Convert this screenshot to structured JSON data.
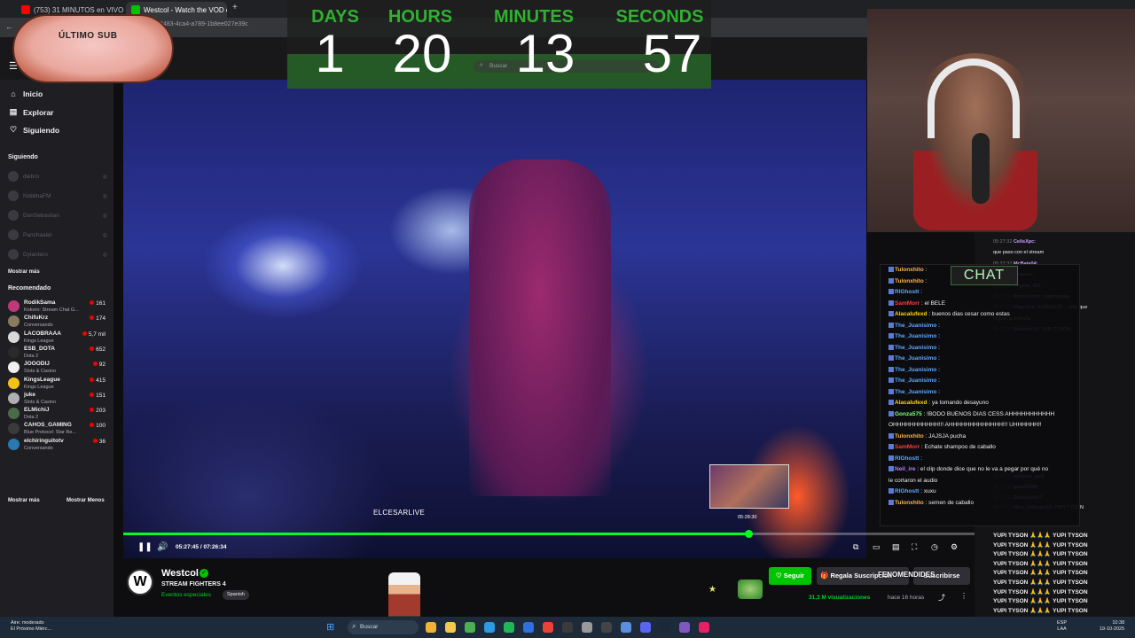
{
  "browser": {
    "tabs": [
      {
        "label": "(753) 31 MINUTOS en VIVO - T",
        "favicon_color": "#ff0000"
      },
      {
        "label": "Westcol - Watch the VOD o",
        "favicon_color": "#00c400"
      }
    ],
    "new_tab": "+",
    "address_fragment": "3483-4ca4-a789-1b8ee027e39c"
  },
  "countdown": {
    "labels": [
      "DAYS",
      "HOURS",
      "MINUTES",
      "SECONDS"
    ],
    "values": [
      "1",
      "20",
      "13",
      "57"
    ],
    "search_placeholder": "Buscar"
  },
  "badge": {
    "text": "ÚLTIMO SUB"
  },
  "sidebar": {
    "nav": [
      {
        "label": "Inicio",
        "icon": "home-icon"
      },
      {
        "label": "Explorar",
        "icon": "browse-icon"
      },
      {
        "label": "Siguiendo",
        "icon": "heart-icon"
      }
    ],
    "following_title": "Siguiendo",
    "following": [
      "diebro",
      "NobilnaFM",
      "DonSebastian",
      "Panchaalel",
      "Dylantero"
    ],
    "show_more": "Mostrar más",
    "recommended_title": "Recomendado",
    "recommended": [
      {
        "name": "RodikSama",
        "game": "Kokoro: Stream Chat G...",
        "viewers": "161",
        "color": "#c03a7a"
      },
      {
        "name": "ChifuKrz",
        "game": "Conversando",
        "viewers": "174",
        "color": "#8a7a60"
      },
      {
        "name": "LACOBRAAA",
        "game": "Kings League",
        "viewers": "5,7 mil",
        "color": "#d9d9d9"
      },
      {
        "name": "ESB_DOTA",
        "game": "Dota 2",
        "viewers": "652",
        "color": "#2a2a2a"
      },
      {
        "name": "JOOODIJ",
        "game": "Slots & Casino",
        "viewers": "92",
        "color": "#f0f0f0"
      },
      {
        "name": "KingsLeague",
        "game": "Kings League",
        "viewers": "415",
        "color": "#f2c21b"
      },
      {
        "name": "juke",
        "game": "Slots & Casino",
        "viewers": "151",
        "color": "#b0b0b0"
      },
      {
        "name": "ELMichiJ",
        "game": "Dota 2",
        "viewers": "203",
        "color": "#4a6a4a"
      },
      {
        "name": "CAHOS_GAMING",
        "game": "Blue Protocol: Star Re...",
        "viewers": "100",
        "color": "#3a3a3a"
      },
      {
        "name": "elchiringuitotv",
        "game": "Conversando",
        "viewers": "36",
        "color": "#2a7ab0"
      }
    ],
    "show_more_bottom": "Mostrar más",
    "show_less": "Mostrar Menos"
  },
  "player": {
    "caption": "ELCESARLIVE",
    "thumb_time": "05:28:30",
    "time_current": "05:27:45",
    "time_total": "07:26:34",
    "progress_fraction": 0.734
  },
  "chat": {
    "label": "CHAT",
    "lines": [
      {
        "user": "Tulonxhito",
        "text": "",
        "color": "#ffb347"
      },
      {
        "user": "Tulonxhito",
        "text": "",
        "color": "#ffb347"
      },
      {
        "user": "RIGhostt",
        "text": "",
        "color": "#5fa8ff"
      },
      {
        "user": "SamMorr",
        "text": "el BELÉ",
        "color": "#ff3b3b"
      },
      {
        "user": "Alacalufexd",
        "text": "buenos dias cesar como estas",
        "color": "#ffd700"
      },
      {
        "user": "The_Juanisimo",
        "text": "",
        "color": "#5fa8ff"
      },
      {
        "user": "The_Juanisimo",
        "text": "",
        "color": "#5fa8ff"
      },
      {
        "user": "The_Juanisimo",
        "text": "",
        "color": "#5fa8ff"
      },
      {
        "user": "The_Juanisimo",
        "text": "",
        "color": "#5fa8ff"
      },
      {
        "user": "The_Juanisimo",
        "text": "",
        "color": "#5fa8ff"
      },
      {
        "user": "The_Juanisimo",
        "text": "",
        "color": "#5fa8ff"
      },
      {
        "user": "The_Juanisimo",
        "text": "",
        "color": "#5fa8ff"
      },
      {
        "user": "Alacalufexd",
        "text": "ya tomando desayuno",
        "color": "#ffd700"
      },
      {
        "user": "Gonza575",
        "text": "!BODO BUENOS DIAS CESS AHHHHHHHHHHH",
        "color": "#7dff7d"
      },
      {
        "user": "",
        "text": "OHHHHHHHHHHH!!! AHHHHHHHHHHHHH!!! UHHHHHH!!",
        "color": "#efeff1"
      },
      {
        "user": "Tulonxhito",
        "text": "JAJSJA pucha",
        "color": "#ffb347"
      },
      {
        "user": "SamMorr",
        "text": "Echate shampoo de caballo",
        "color": "#ff3b3b"
      },
      {
        "user": "RIGhostt",
        "text": "",
        "color": "#5fa8ff"
      },
      {
        "user": "Neil_ire",
        "text": "el clip donde dice que no le va a pegar por qué no",
        "color": "#b57dff"
      },
      {
        "user": "",
        "text": "le cortaron el audio",
        "color": "#efeff1"
      },
      {
        "user": "RIGhostt",
        "text": "xuxu",
        "color": "#5fa8ff"
      },
      {
        "user": "Tulonxhito",
        "text": "semen de caballo",
        "color": "#ffb347"
      }
    ],
    "bg_lines": [
      {
        "time": "05:27:32",
        "user": "CelisXpc:",
        "text": ""
      },
      {
        "time": "",
        "user": "",
        "text": "que paso con el stream"
      },
      {
        "time": "05:27:32",
        "user": "McBate04:",
        "text": ""
      },
      {
        "time": "05:27:32",
        "user": "naoyare:",
        "text": ""
      },
      {
        "time": "05:27:32",
        "user": "Angela_382",
        "text": ""
      },
      {
        "time": "05:27:32",
        "user": "Kamrkanha:",
        "text": "sigantesaaa"
      },
      {
        "time": "05:27:32",
        "user": "Miguelos:",
        "text": "318900143 ... anie que"
      },
      {
        "time": "",
        "user": "",
        "text": "miguel la extraña"
      },
      {
        "time": "05:27:32",
        "user": "Sebastrl14:",
        "text": "YUPI TYSON"
      }
    ],
    "yupi_line": "YUPI TYSON",
    "tail": [
      {
        "time": "05:27:32",
        "user": "adrianw_god:",
        "text": ""
      },
      {
        "time": "05:27:32",
        "user": "gabifi2299:",
        "text": ""
      },
      {
        "time": "05:27:32",
        "user": "Danaocfie07:",
        "text": ""
      },
      {
        "time": "05:27:32",
        "user": "Nico_delhodo22:",
        "text": "YUPI TYSON"
      }
    ]
  },
  "channel": {
    "name": "Westcol",
    "logo_letter": "W",
    "title": "STREAM FIGHTERS 4",
    "category": "Eventos especiales",
    "language": "Spanish",
    "follow_label": "Seguir",
    "gift_label": "Regala Suscripción",
    "sub_label": "Suscribirse",
    "overlay_text": "FENOMENDIDES",
    "views": "31,3 M visualizaciones",
    "ago": "hace 16 horas"
  },
  "taskbar": {
    "weather": [
      "Aire: moderado",
      "El Próximo Miérc..."
    ],
    "search_placeholder": "Buscar",
    "tray": [
      "ESP",
      "LAA"
    ],
    "clock": [
      "10:38",
      "19-10-2025"
    ]
  }
}
